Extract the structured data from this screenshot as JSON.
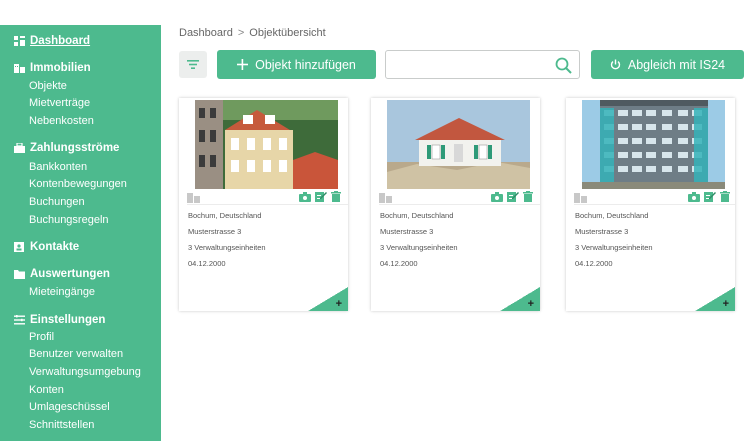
{
  "colors": {
    "accent": "#4dba8e",
    "sidebar_bg": "#4dba8e"
  },
  "sidebar": {
    "dashboard": {
      "label": "Dashboard",
      "icon": "dashboard-icon"
    },
    "sections": [
      {
        "label": "Immobilien",
        "icon": "building-icon",
        "items": [
          "Objekte",
          "Mietverträge",
          "Nebenkosten"
        ]
      },
      {
        "label": "Zahlungsströme",
        "icon": "briefcase-icon",
        "items": [
          "Bankkonten",
          "Kontenbewegungen",
          "Buchungen",
          "Buchungsregeln"
        ]
      },
      {
        "label": "Kontakte",
        "icon": "contacts-icon",
        "items": []
      },
      {
        "label": "Auswertungen",
        "icon": "folder-icon",
        "items": [
          "Mieteingänge"
        ]
      },
      {
        "label": "Einstellungen",
        "icon": "settings-list-icon",
        "items": [
          "Profil",
          "Benutzer verwalten",
          "Verwaltungsumgebung",
          "Konten",
          "Umlageschüssel",
          "Schnittstellen"
        ]
      }
    ]
  },
  "breadcrumb": {
    "home": "Dashboard",
    "separator": ">",
    "current": "Objektübersicht"
  },
  "toolbar": {
    "filter_icon": "filter-icon",
    "add_label": "Objekt hinzufügen",
    "search_value": "",
    "search_icon": "search-icon",
    "sync_label": "Abgleich mit IS24"
  },
  "cards": [
    {
      "location": "Bochum, Deutschland",
      "street": "Musterstrasse 3",
      "units": "3 Verwaltungseinheiten",
      "date": "04.12.2000"
    },
    {
      "location": "Bochum, Deutschland",
      "street": "Musterstrasse 3",
      "units": "3 Verwaltungseinheiten",
      "date": "04.12.2000"
    },
    {
      "location": "Bochum, Deutschland",
      "street": "Musterstrasse 3",
      "units": "3 Verwaltungseinheiten",
      "date": "04.12.2000"
    }
  ]
}
